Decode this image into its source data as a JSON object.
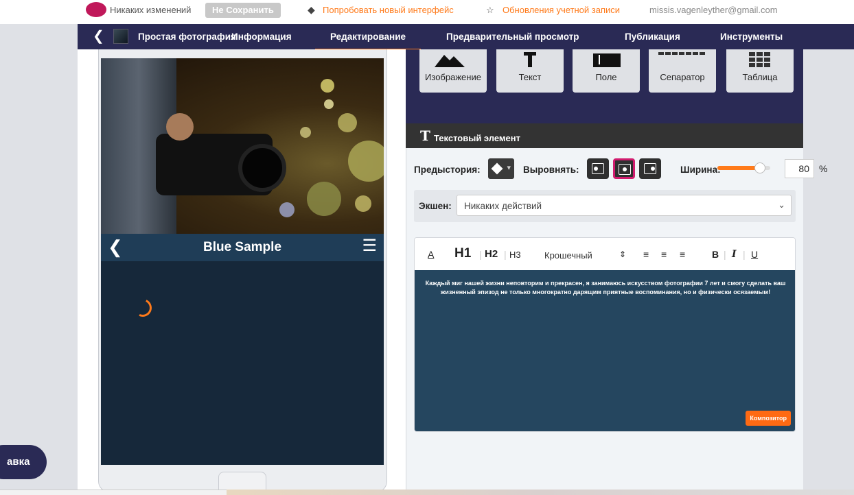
{
  "topbar": {
    "changes_text": "Никаких изменений",
    "save_label": "Не Сохранить",
    "try_new_label": "Попробовать новый интерфейс",
    "account_updates_label": "Обновления учетной записи",
    "email": "missis.vagenleyther@gmail.com"
  },
  "nav": {
    "app_title": "Простая фотография",
    "tabs": [
      {
        "label": "Информация"
      },
      {
        "label": "Редактирование",
        "active": true
      },
      {
        "label": "Предварительный просмотр"
      },
      {
        "label": "Публикация"
      },
      {
        "label": "Инструменты"
      }
    ]
  },
  "preview": {
    "header_title": "Blue Sample"
  },
  "tools": [
    {
      "label": "Изображение",
      "icon": "image-icon"
    },
    {
      "label": "Текст",
      "icon": "text-icon"
    },
    {
      "label": "Поле",
      "icon": "field-icon"
    },
    {
      "label": "Сепаратор",
      "icon": "separator-icon"
    },
    {
      "label": "Таблица",
      "icon": "table-icon"
    }
  ],
  "text_element": {
    "section_title": "Текстовый элемент",
    "background_label": "Предыстория:",
    "align_label": "Выровнять:",
    "width_label": "Ширина:",
    "width_value": "80",
    "width_unit": "%",
    "width_fraction": 0.8,
    "action_label": "Экшен:",
    "action_value": "Никаких действий"
  },
  "editor": {
    "toolbar": {
      "color": "A",
      "h1": "H1",
      "h2": "H2",
      "h3": "H3",
      "size": "Крошечный",
      "bold": "B",
      "italic": "I",
      "underline": "U"
    },
    "content_text": "Каждый миг нашей жизни неповторим и прекрасен, я занимаюсь искусством фотографии 7 лет и смогу сделать ваш жизненный эпизод не только многократно дарящим приятные воспоминания, но и физически осязаемым!",
    "composer_label": "Композитор"
  },
  "help_button": {
    "label": "авка"
  },
  "colors": {
    "nav_bg": "#2a2a55",
    "accent": "#ff7a1a",
    "selected_border": "#d11b6e",
    "preview_header": "#1f3d57",
    "preview_bg": "#16283a",
    "editor_bg": "#25465f"
  }
}
